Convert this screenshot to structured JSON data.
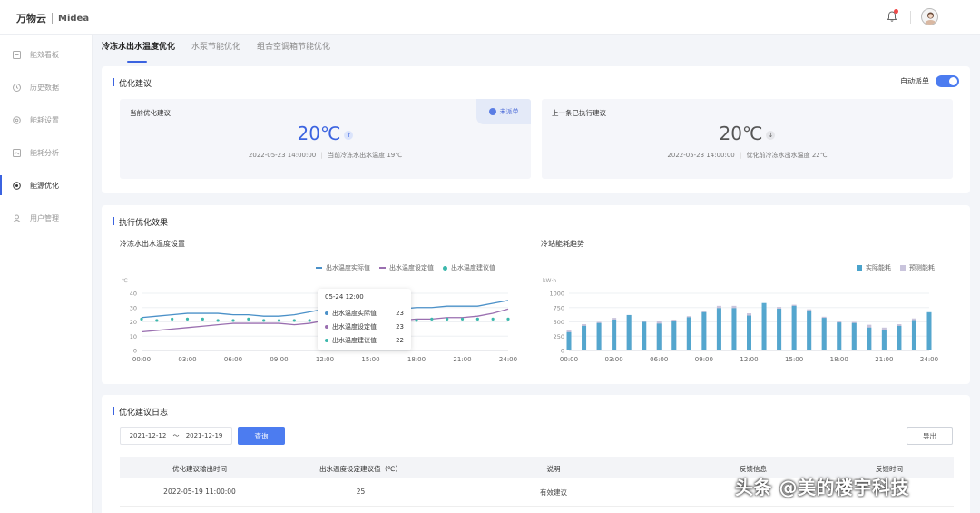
{
  "header": {
    "logo_text": "万物云",
    "brand": "Midea"
  },
  "sidebar": {
    "items": [
      {
        "label": "能效看板",
        "icon": "dashboard-icon"
      },
      {
        "label": "历史数据",
        "icon": "history-icon"
      },
      {
        "label": "能耗设置",
        "icon": "settings-icon"
      },
      {
        "label": "能耗分析",
        "icon": "analysis-icon"
      },
      {
        "label": "能源优化",
        "icon": "optimize-icon",
        "active": true
      },
      {
        "label": "用户管理",
        "icon": "user-icon"
      }
    ]
  },
  "tabs": [
    {
      "label": "冷冻水出水温度优化",
      "active": true
    },
    {
      "label": "水泵节能优化"
    },
    {
      "label": "组合空调箱节能优化"
    }
  ],
  "suggestion": {
    "title": "优化建议",
    "auto_dispatch_label": "自动派单",
    "auto_dispatch_on": true,
    "current": {
      "title": "当前优化建议",
      "value": "20℃",
      "arrow": "↑",
      "time": "2022-05-23 14:00:00",
      "note": "当前冷冻水出水温度 19℃",
      "badge": "未派单"
    },
    "last": {
      "title": "上一条已执行建议",
      "value": "20℃",
      "arrow": "↓",
      "time": "2022-05-23 14:00:00",
      "note": "优化前冷冻水出水温度 22℃"
    }
  },
  "effect": {
    "title": "执行优化效果",
    "colors": {
      "actual": "#4a90c8",
      "setpoint": "#9a6fb0",
      "suggest": "#3cb8ac",
      "energy_actual": "#4aa3cc",
      "energy_pred": "#c9c4dc"
    },
    "left_chart_title": "冷冻水出水温度设置",
    "right_chart_title": "冷站能耗趋势",
    "legend_left": [
      "出水温度实际值",
      "出水温度设定值",
      "出水温度建议值"
    ],
    "legend_right": [
      "实际能耗",
      "预测能耗"
    ],
    "left_unit": "℃",
    "right_unit": "kW·h",
    "tooltip": {
      "time": "05-24 12:00",
      "rows": [
        {
          "label": "出水温度实际值",
          "value": "23"
        },
        {
          "label": "出水温度设定值",
          "value": "23"
        },
        {
          "label": "出水温度建议值",
          "value": "22"
        }
      ]
    }
  },
  "chart_data": [
    {
      "type": "line",
      "title": "冷冻水出水温度设置",
      "ylabel": "℃",
      "ylim": [
        0,
        40
      ],
      "yticks": [
        0,
        10,
        20,
        30,
        40
      ],
      "x_ticks": [
        "00:00",
        "03:00",
        "06:00",
        "09:00",
        "12:00",
        "15:00",
        "18:00",
        "21:00",
        "24:00"
      ],
      "x": [
        0,
        1,
        2,
        3,
        4,
        5,
        6,
        7,
        8,
        9,
        10,
        11,
        12,
        13,
        14,
        15,
        16,
        17,
        18,
        19,
        20,
        21,
        22,
        23,
        24
      ],
      "series": [
        {
          "name": "出水温度实际值",
          "style": "line",
          "values": [
            23,
            24,
            25,
            26,
            26,
            26,
            25,
            25,
            24,
            24,
            25,
            27,
            29,
            30,
            31,
            31,
            30,
            29,
            30,
            30,
            31,
            31,
            31,
            33,
            35
          ]
        },
        {
          "name": "出水温度设定值",
          "style": "line",
          "values": [
            13,
            14,
            15,
            16,
            17,
            18,
            19,
            19,
            19,
            19,
            18,
            19,
            21,
            22,
            23,
            23,
            22,
            21,
            22,
            22,
            23,
            23,
            24,
            26,
            29
          ]
        },
        {
          "name": "出水温度建议值",
          "style": "dots",
          "values": [
            22,
            21,
            22,
            22,
            22,
            21,
            21,
            22,
            21,
            21,
            21,
            21,
            22,
            22,
            22,
            22,
            22,
            22,
            21,
            22,
            22,
            22,
            22,
            22,
            22
          ]
        }
      ]
    },
    {
      "type": "bar",
      "title": "冷站能耗趋势",
      "ylabel": "kW·h",
      "ylim": [
        0,
        1000
      ],
      "yticks": [
        0,
        250,
        500,
        750,
        1000
      ],
      "x_ticks": [
        "00:00",
        "03:00",
        "06:00",
        "09:00",
        "12:00",
        "15:00",
        "18:00",
        "21:00",
        "24:00"
      ],
      "x": [
        0,
        1,
        2,
        3,
        4,
        5,
        6,
        7,
        8,
        9,
        10,
        11,
        12,
        13,
        14,
        15,
        16,
        17,
        18,
        19,
        20,
        21,
        22,
        23,
        24
      ],
      "series": [
        {
          "name": "实际能耗",
          "values": [
            320,
            430,
            480,
            540,
            620,
            500,
            470,
            520,
            580,
            670,
            740,
            740,
            610,
            830,
            730,
            780,
            700,
            570,
            490,
            480,
            400,
            360,
            430,
            530,
            670
          ]
        },
        {
          "name": "预测能耗",
          "values": [
            350,
            460,
            500,
            570,
            620,
            520,
            520,
            540,
            600,
            680,
            780,
            780,
            650,
            720,
            760,
            800,
            720,
            590,
            520,
            500,
            450,
            400,
            460,
            560,
            650
          ]
        }
      ]
    }
  ],
  "log": {
    "title": "优化建议日志",
    "date_from": "2021-12-12",
    "date_sep": "～",
    "date_to": "2021-12-19",
    "query_label": "查询",
    "export_label": "导出",
    "columns": [
      "优化建议输出时间",
      "出水温度设定建议值（℃）",
      "说明",
      "反馈信息",
      "反馈时间"
    ],
    "rows": [
      [
        "2022-05-19 11:00:00",
        "25",
        "有效建议",
        "",
        ""
      ]
    ]
  },
  "watermark": "头条 @美的楼宇科技"
}
